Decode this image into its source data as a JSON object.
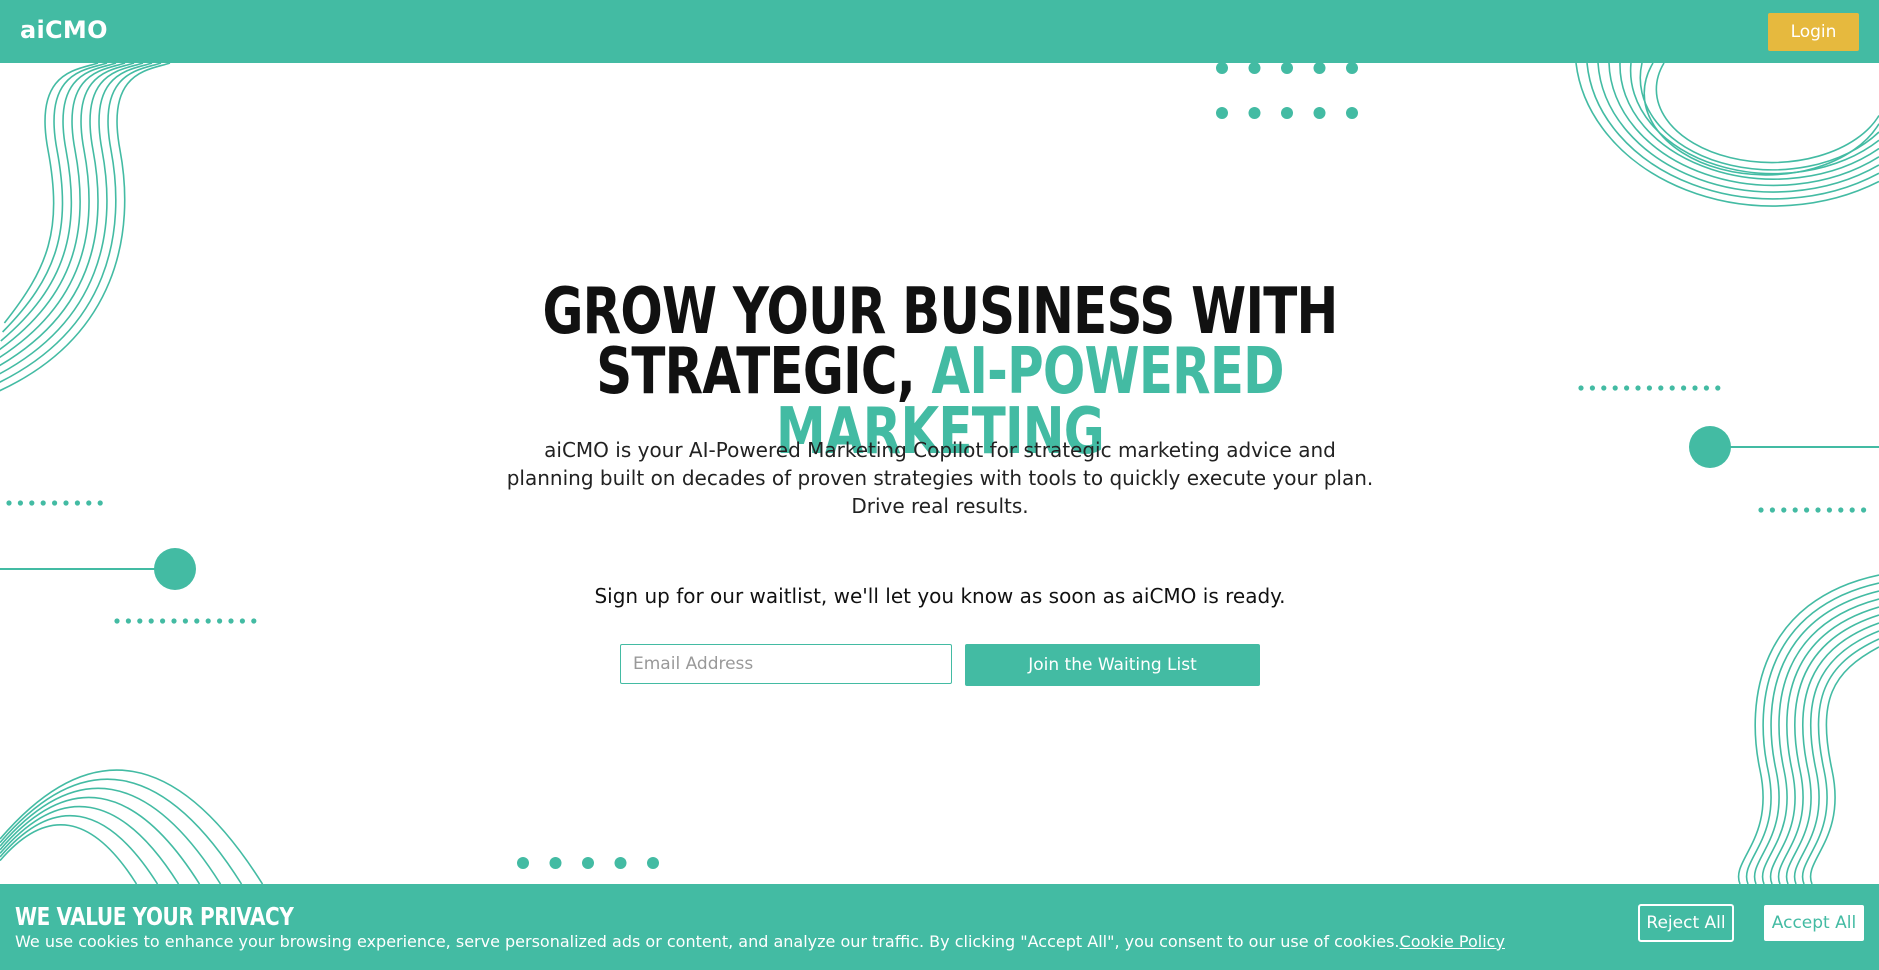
{
  "header": {
    "logo": "aiCMO",
    "login_label": "Login"
  },
  "hero": {
    "title_main": "GROW YOUR BUSINESS WITH STRATEGIC, ",
    "title_accent": "AI-POWERED MARKETING",
    "subtitle_line1": "aiCMO is your AI-Powered Marketing Copilot for strategic marketing advice and",
    "subtitle_line2": "planning built on decades of proven strategies with tools to quickly execute your plan.",
    "subtitle_line3": "Drive real results."
  },
  "waitlist": {
    "text": "Sign up for our waitlist, we'll let you know as soon as aiCMO is ready.",
    "email_placeholder": "Email Address",
    "join_label": "Join the Waiting List"
  },
  "cookie": {
    "title": "WE VALUE YOUR PRIVACY",
    "text": "We use cookies to enhance your browsing experience, serve personalized ads or content, and analyze our traffic. By clicking \"Accept All\", you consent to our use of cookies.",
    "policy_link": "Cookie Policy",
    "reject_label": "Reject All",
    "accept_label": "Accept All"
  },
  "colors": {
    "brand": "#43bba3",
    "login": "#e6b93e"
  }
}
